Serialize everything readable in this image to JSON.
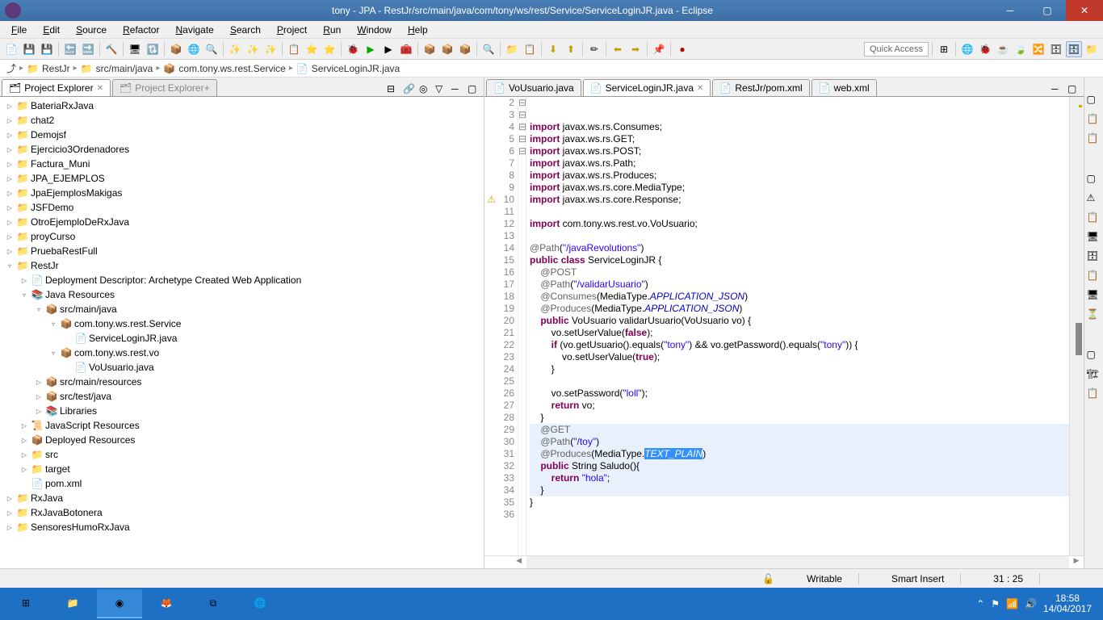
{
  "titlebar": {
    "title": "tony - JPA - RestJr/src/main/java/com/tony/ws/rest/Service/ServiceLoginJR.java - Eclipse"
  },
  "menubar": [
    "File",
    "Edit",
    "Source",
    "Refactor",
    "Navigate",
    "Search",
    "Project",
    "Run",
    "Window",
    "Help"
  ],
  "quickAccess": "Quick Access",
  "breadcrumb": [
    "RestJr",
    "src/main/java",
    "com.tony.ws.rest.Service",
    "ServiceLoginJR.java"
  ],
  "projectExplorer": {
    "title": "Project Explorer",
    "plusTitle": "Project Explorer+"
  },
  "tree": [
    {
      "i": 0,
      "t": "▷",
      "ic": "proj",
      "l": "BateriaRxJava"
    },
    {
      "i": 0,
      "t": "▷",
      "ic": "proj",
      "l": "chat2"
    },
    {
      "i": 0,
      "t": "▷",
      "ic": "proj",
      "l": "Demojsf"
    },
    {
      "i": 0,
      "t": "▷",
      "ic": "proj",
      "l": "Ejercicio3Ordenadores"
    },
    {
      "i": 0,
      "t": "▷",
      "ic": "proj",
      "l": "Factura_Muni"
    },
    {
      "i": 0,
      "t": "▷",
      "ic": "proj",
      "l": "JPA_EJEMPLOS"
    },
    {
      "i": 0,
      "t": "▷",
      "ic": "proj",
      "l": "JpaEjemplosMakigas"
    },
    {
      "i": 0,
      "t": "▷",
      "ic": "proj",
      "l": "JSFDemo"
    },
    {
      "i": 0,
      "t": "▷",
      "ic": "proj",
      "l": "OtroEjemploDeRxJava"
    },
    {
      "i": 0,
      "t": "▷",
      "ic": "proj",
      "l": "proyCurso"
    },
    {
      "i": 0,
      "t": "▷",
      "ic": "proj",
      "l": "PruebaRestFull"
    },
    {
      "i": 0,
      "t": "▿",
      "ic": "proj",
      "l": "RestJr"
    },
    {
      "i": 1,
      "t": "▷",
      "ic": "dd",
      "l": "Deployment Descriptor: Archetype Created Web Application"
    },
    {
      "i": 1,
      "t": "▿",
      "ic": "jres",
      "l": "Java Resources"
    },
    {
      "i": 2,
      "t": "▿",
      "ic": "srcf",
      "l": "src/main/java"
    },
    {
      "i": 3,
      "t": "▿",
      "ic": "pkg",
      "l": "com.tony.ws.rest.Service"
    },
    {
      "i": 4,
      "t": "",
      "ic": "java",
      "l": "ServiceLoginJR.java"
    },
    {
      "i": 3,
      "t": "▿",
      "ic": "pkg",
      "l": "com.tony.ws.rest.vo"
    },
    {
      "i": 4,
      "t": "",
      "ic": "java",
      "l": "VoUsuario.java"
    },
    {
      "i": 2,
      "t": "▷",
      "ic": "srcf",
      "l": "src/main/resources"
    },
    {
      "i": 2,
      "t": "▷",
      "ic": "srcf",
      "l": "src/test/java"
    },
    {
      "i": 2,
      "t": "▷",
      "ic": "lib",
      "l": "Libraries"
    },
    {
      "i": 1,
      "t": "▷",
      "ic": "js",
      "l": "JavaScript Resources"
    },
    {
      "i": 1,
      "t": "▷",
      "ic": "dep",
      "l": "Deployed Resources"
    },
    {
      "i": 1,
      "t": "▷",
      "ic": "fld",
      "l": "src"
    },
    {
      "i": 1,
      "t": "▷",
      "ic": "fld",
      "l": "target"
    },
    {
      "i": 1,
      "t": "",
      "ic": "xml",
      "l": "pom.xml"
    },
    {
      "i": 0,
      "t": "▷",
      "ic": "proj",
      "l": "RxJava"
    },
    {
      "i": 0,
      "t": "▷",
      "ic": "proj",
      "l": "RxJavaBotonera"
    },
    {
      "i": 0,
      "t": "▷",
      "ic": "proj",
      "l": "SensoresHumoRxJava"
    }
  ],
  "editorTabs": [
    {
      "l": "VoUsuario.java",
      "active": false,
      "ic": "java"
    },
    {
      "l": "ServiceLoginJR.java",
      "active": true,
      "ic": "java"
    },
    {
      "l": "RestJr/pom.xml",
      "active": false,
      "ic": "xml"
    },
    {
      "l": "web.xml",
      "active": false,
      "ic": "xml"
    }
  ],
  "code": {
    "start": 2,
    "lines": [
      "",
      "",
      "<kw>import</kw> javax.ws.rs.Consumes;",
      "<kw>import</kw> javax.ws.rs.GET;",
      "<kw>import</kw> javax.ws.rs.POST;",
      "<kw>import</kw> javax.ws.rs.Path;",
      "<kw>import</kw> javax.ws.rs.Produces;",
      "<kw>import</kw> javax.ws.rs.core.MediaType;",
      "<kw>import</kw> javax.ws.rs.core.Response;",
      "",
      "<kw>import</kw> com.tony.ws.rest.vo.VoUsuario;",
      "",
      "<ann>@Path</ann>(<str>\"/javaRevolutions\"</str>)",
      "<kw>public</kw> <kw>class</kw> ServiceLoginJR {",
      "    <ann>@POST</ann>",
      "    <ann>@Path</ann>(<str>\"/validarUsuario\"</str>)",
      "    <ann>@Consumes</ann>(MediaType.<static-it>APPLICATION_JSON</static-it>)",
      "    <ann>@Produces</ann>(MediaType.<static-it>APPLICATION_JSON</static-it>)",
      "    <kw>public</kw> VoUsuario validarUsuario(VoUsuario vo) {",
      "        vo.setUserValue(<kw>false</kw>);",
      "        <kw>if</kw> (vo.getUsuario().equals(<str>\"tony\"</str>) && vo.getPassword().equals(<str>\"tony\"</str>)) {",
      "            vo.setUserValue(<kw>true</kw>);",
      "        }",
      "",
      "        vo.setPassword(<str>\"loll\"</str>);",
      "        <kw>return</kw> vo;",
      "    }",
      "    <ann>@GET</ann>",
      "    <ann>@Path</ann>(<str>\"/toy\"</str>)",
      "    <ann>@Produces</ann>(MediaType.<sel><i>TEXT_PLAIN</i></sel>)",
      "    <kw>public</kw> String Saludo(){",
      "        <kw>return</kw> <str>\"hola\"</str>;",
      "    }",
      "}",
      ""
    ],
    "highlightFrom": 29,
    "highlightTo": 34,
    "foldable": [
      16,
      20,
      22,
      29,
      32
    ],
    "closers": [
      24,
      28,
      34,
      35
    ],
    "warnLine": 10
  },
  "status": {
    "writable": "Writable",
    "insert": "Smart Insert",
    "pos": "31 : 25"
  },
  "systray": {
    "time": "18:58",
    "date": "14/04/2017"
  }
}
